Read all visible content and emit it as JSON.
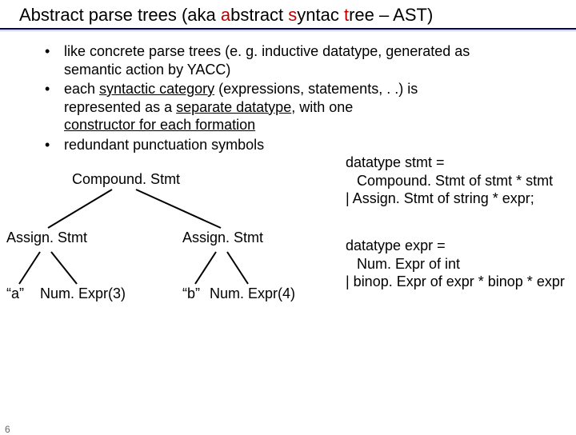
{
  "title": {
    "pre": "Abstract parse trees (aka ",
    "red1": "a",
    "mid": "bstract ",
    "red2": "s",
    "mid2": "yntac ",
    "red3": "t",
    "post": "ree – AST)"
  },
  "bullets": {
    "b1_l1": "like concrete parse trees (e. g. inductive datatype, generated as",
    "b1_l2": "semantic action by YACC)",
    "b2_l1_a": "each ",
    "b2_l1_u": "syntactic category",
    "b2_l1_b": " (expressions, statements, . .) is",
    "b2_l2_a": "represented as a ",
    "b2_l2_u": "separate datatype",
    "b2_l2_b": ", with one",
    "b2_l3_a": "constructor for each formation",
    "b3_l1": "redundant punctuation symbols"
  },
  "tree": {
    "compound": "Compound. Stmt",
    "assign_left": "Assign. Stmt",
    "assign_right": "Assign. Stmt",
    "leaf_a": "“a”",
    "leaf_a_expr": "Num. Expr(3)",
    "leaf_b": "“b”",
    "leaf_b_expr": "Num. Expr(4)"
  },
  "code1": {
    "l1": "datatype stmt =",
    "l2": "Compound. Stmt of stmt * stmt",
    "l3": "| Assign. Stmt of string * expr;"
  },
  "code2": {
    "l1": "datatype expr =",
    "l2": "Num. Expr of int",
    "l3": "| binop. Expr of expr * binop * expr"
  },
  "page": "6"
}
